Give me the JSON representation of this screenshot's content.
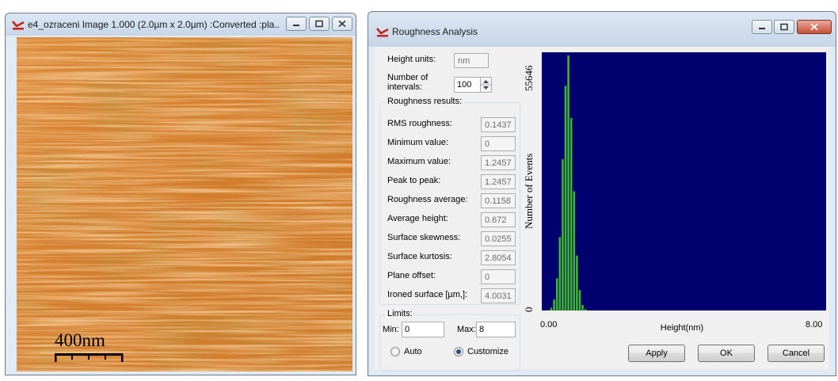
{
  "image_window": {
    "title": "e4_ozraceni Image 1.000 (2.0µm x 2.0µm) :Converted :pla...",
    "scale_label": "400nm"
  },
  "roughness_window": {
    "title": "Roughness Analysis",
    "height_units_label": "Height units:",
    "height_units_value": "nm",
    "intervals_label_1": "Number of",
    "intervals_label_2": "intervals:",
    "intervals_value": "100",
    "results_title": "Roughness results:",
    "results": [
      {
        "label": "RMS roughness:",
        "value": "0.1437"
      },
      {
        "label": "Minimum value:",
        "value": "0"
      },
      {
        "label": "Maximum value:",
        "value": "1.2457"
      },
      {
        "label": "Peak  to peak:",
        "value": "1.2457"
      },
      {
        "label": "Roughness average:",
        "value": "0.1158"
      },
      {
        "label": "Average height:",
        "value": "0.672"
      },
      {
        "label": "Surface skewness:",
        "value": "0.0255"
      },
      {
        "label": "Surface kurtosis:",
        "value": "2.8054"
      },
      {
        "label": "Plane offset:",
        "value": "0"
      },
      {
        "label": "Ironed surface [µm,]:",
        "value": "4.0031"
      }
    ],
    "limits_title": "Limits:",
    "min_label": "Min:",
    "min_value": "0",
    "max_label": "Max:",
    "max_value": "8",
    "auto_label": "Auto",
    "customize_label": "Customize",
    "apply_label": "Apply",
    "ok_label": "OK",
    "cancel_label": "Cancel"
  },
  "colors": {
    "plot_background": "#00006e",
    "histogram_bars": "#3fb52a",
    "afm_dark": "#b85c14",
    "afm_light": "#f4b878"
  },
  "chart_data": {
    "type": "bar",
    "xlabel": "Height(nm)",
    "ylabel": "Number of Events",
    "xlim": [
      0,
      8
    ],
    "ylim": [
      0,
      55646
    ],
    "x_tick_labels": [
      "0.00",
      "8.00"
    ],
    "y_tick_labels": [
      "0",
      "55646"
    ],
    "bin_width": 0.08,
    "x": [
      0.16,
      0.24,
      0.32,
      0.4,
      0.48,
      0.56,
      0.64,
      0.72,
      0.8,
      0.88,
      0.96,
      1.04,
      1.12,
      1.2
    ],
    "values": [
      100,
      600,
      2400,
      7000,
      16000,
      33000,
      49000,
      55646,
      42000,
      26000,
      12000,
      4500,
      1200,
      300
    ]
  }
}
